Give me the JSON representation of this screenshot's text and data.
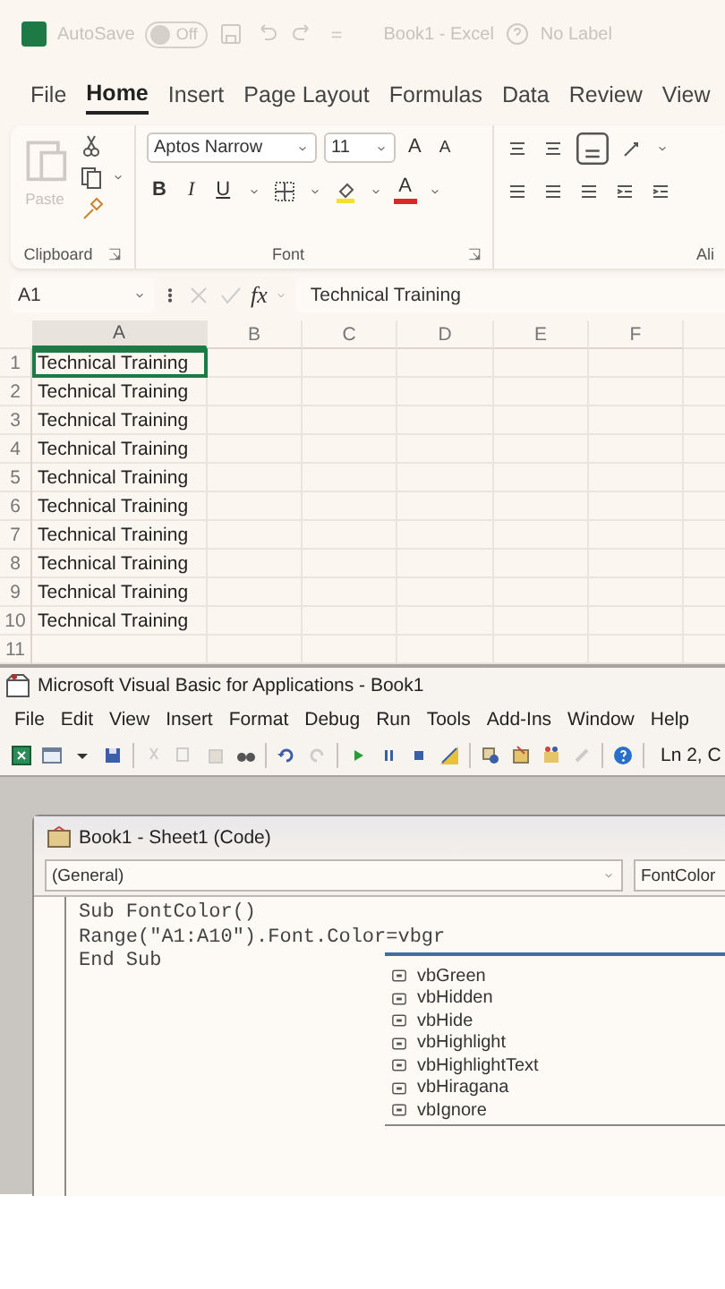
{
  "title_bar": {
    "autosave_label": "AutoSave",
    "autosave": {
      "on": false,
      "label": "Off"
    },
    "document_title": "Book1  -  Excel",
    "sensitivity": "No Label"
  },
  "ribbon_tabs": [
    {
      "label": "File",
      "selected": false
    },
    {
      "label": "Home",
      "selected": true
    },
    {
      "label": "Insert",
      "selected": false
    },
    {
      "label": "Page Layout",
      "selected": false
    },
    {
      "label": "Formulas",
      "selected": false
    },
    {
      "label": "Data",
      "selected": false
    },
    {
      "label": "Review",
      "selected": false
    },
    {
      "label": "View",
      "selected": false
    }
  ],
  "ribbon": {
    "clipboard": {
      "paste": "Paste",
      "group_label": "Clipboard"
    },
    "font": {
      "font_name": "Aptos Narrow",
      "font_size": "11",
      "grow": "A",
      "shrink": "A",
      "bold": "B",
      "italic": "I",
      "underline": "U",
      "font_color": "A",
      "group_label": "Font"
    },
    "alignment": {
      "group_label": "Ali"
    }
  },
  "formula_bar": {
    "name_box": "A1",
    "fx": "fx",
    "value": "Technical Training"
  },
  "sheet": {
    "columns": [
      "A",
      "B",
      "C",
      "D",
      "E",
      "F"
    ],
    "rows": [
      {
        "number": "1",
        "cell": "Technical Training",
        "selected": true
      },
      {
        "number": "2",
        "cell": "Technical Training",
        "selected": false
      },
      {
        "number": "3",
        "cell": "Technical Training",
        "selected": false
      },
      {
        "number": "4",
        "cell": "Technical Training",
        "selected": false
      },
      {
        "number": "5",
        "cell": "Technical Training",
        "selected": false
      },
      {
        "number": "6",
        "cell": "Technical Training",
        "selected": false
      },
      {
        "number": "7",
        "cell": "Technical Training",
        "selected": false
      },
      {
        "number": "8",
        "cell": "Technical Training",
        "selected": false
      },
      {
        "number": "9",
        "cell": "Technical Training",
        "selected": false
      },
      {
        "number": "10",
        "cell": "Technical Training",
        "selected": false
      },
      {
        "number": "11",
        "selected": false
      }
    ]
  },
  "vba": {
    "title": "Microsoft Visual Basic for Applications - Book1",
    "menu": [
      "File",
      "Edit",
      "View",
      "Insert",
      "Format",
      "Debug",
      "Run",
      "Tools",
      "Add-Ins",
      "Window",
      "Help"
    ],
    "status": "Ln 2, C",
    "code_window": {
      "title": "Book1 - Sheet1 (Code)",
      "object_box": "(General)",
      "procedure_box": "FontColor",
      "code": [
        "Sub FontColor()",
        "Range(\"A1:A10\").Font.Color=vbgr",
        "End Sub"
      ],
      "autocomplete": [
        "vbGreen",
        "vbHidden",
        "vbHide",
        "vbHighlight",
        "vbHighlightText",
        "vbHiragana",
        "vbIgnore"
      ]
    }
  }
}
